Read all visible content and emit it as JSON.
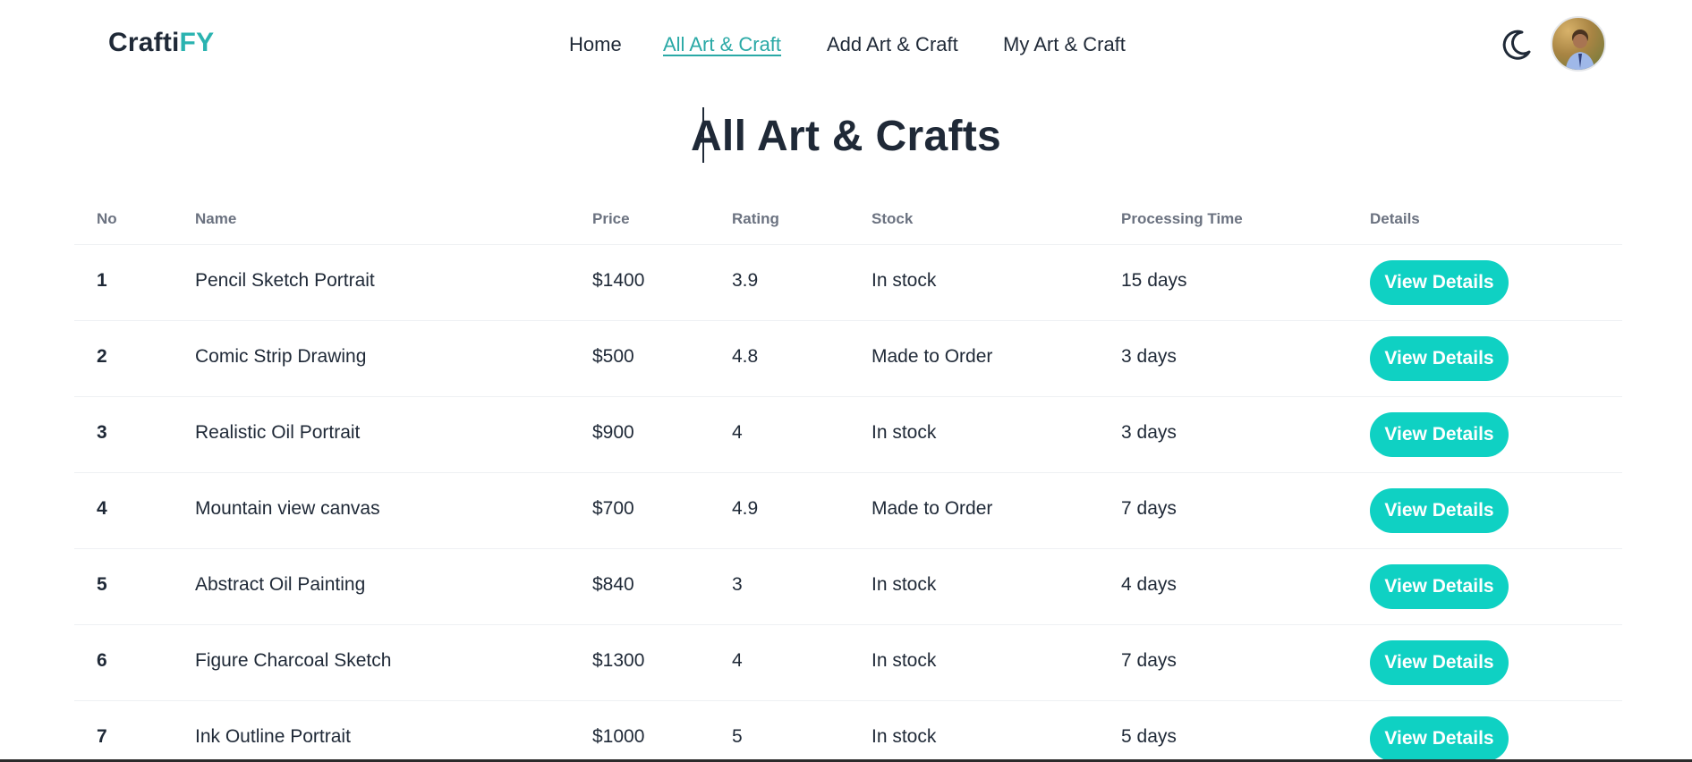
{
  "brand": {
    "part1": "Crafti",
    "part2": "FY",
    "accent_color": "#2ab3b0"
  },
  "nav": {
    "items": [
      {
        "label": "Home"
      },
      {
        "label": "All Art & Craft",
        "active": true
      },
      {
        "label": "Add Art & Craft"
      },
      {
        "label": "My Art & Craft"
      }
    ],
    "theme_toggle_icon": "moon-icon",
    "avatar": "user-avatar"
  },
  "page": {
    "title": "All Art & Crafts"
  },
  "table": {
    "headers": {
      "no": "No",
      "name": "Name",
      "price": "Price",
      "rating": "Rating",
      "stock": "Stock",
      "processing": "Processing Time",
      "details": "Details"
    },
    "button_label": "View Details",
    "button_color": "#0fd1c3",
    "rows": [
      {
        "no": "1",
        "name": "Pencil Sketch Portrait",
        "price": "$1400",
        "rating": "3.9",
        "stock": "In stock",
        "processing": "15 days"
      },
      {
        "no": "2",
        "name": "Comic Strip Drawing",
        "price": "$500",
        "rating": "4.8",
        "stock": "Made to Order",
        "processing": "3 days"
      },
      {
        "no": "3",
        "name": "Realistic Oil Portrait",
        "price": "$900",
        "rating": "4",
        "stock": "In stock",
        "processing": "3 days"
      },
      {
        "no": "4",
        "name": "Mountain view canvas",
        "price": "$700",
        "rating": "4.9",
        "stock": "Made to Order",
        "processing": "7 days"
      },
      {
        "no": "5",
        "name": "Abstract Oil Painting",
        "price": "$840",
        "rating": "3",
        "stock": "In stock",
        "processing": "4 days"
      },
      {
        "no": "6",
        "name": "Figure Charcoal Sketch",
        "price": "$1300",
        "rating": "4",
        "stock": "In stock",
        "processing": "7 days"
      },
      {
        "no": "7",
        "name": "Ink Outline Portrait",
        "price": "$1000",
        "rating": "5",
        "stock": "In stock",
        "processing": "5 days"
      }
    ]
  }
}
